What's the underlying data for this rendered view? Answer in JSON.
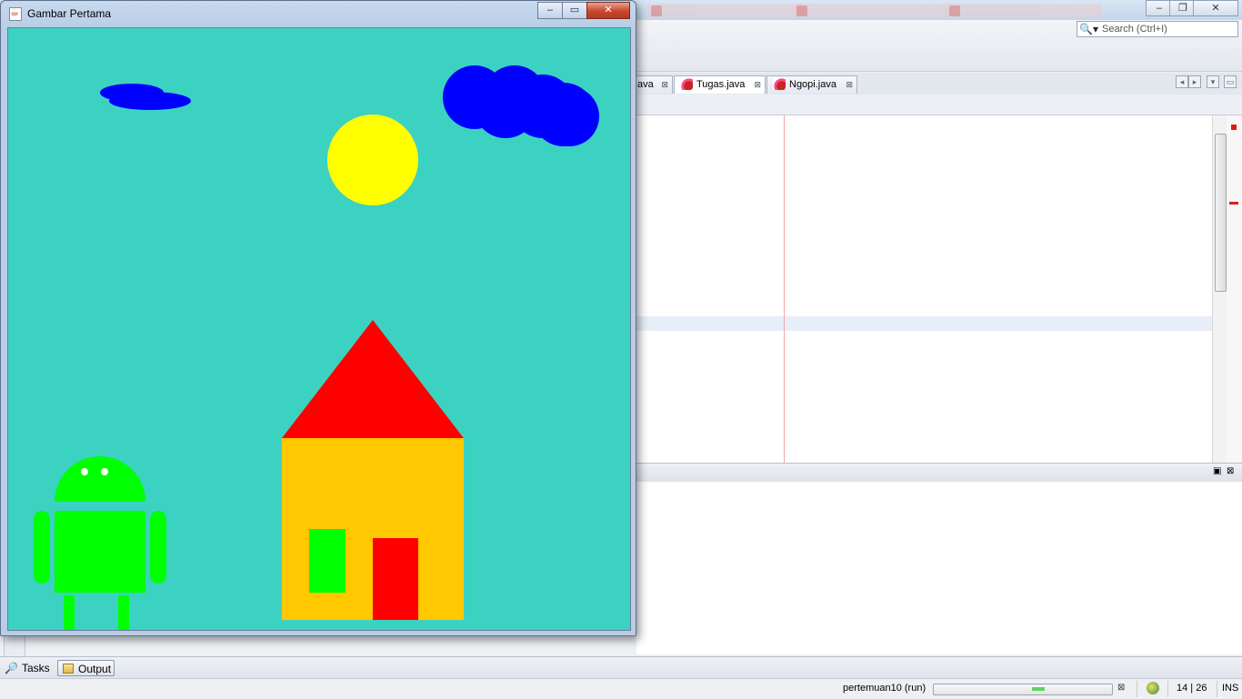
{
  "ide": {
    "search_placeholder": "Search (Ctrl+I)",
    "editor_tabs": [
      {
        "label": "ava",
        "active": false
      },
      {
        "label": "Tugas.java",
        "active": true
      },
      {
        "label": "Ngopi.java",
        "active": false
      }
    ],
    "bottom_tabs": {
      "tasks": "Tasks",
      "output": "Output"
    },
    "status": {
      "run_label": "pertemuan10 (run)",
      "cursor_position": "14 | 26",
      "insert_mode": "INS"
    }
  },
  "java_window": {
    "title": "Gambar Pertama",
    "controls": {
      "minimize": "–",
      "maximize": "▭",
      "close": "✕"
    },
    "scene_colors": {
      "sky": "#3cd2c2",
      "cloud": "#0000ff",
      "sun": "#ffff00",
      "roof": "#ff0000",
      "wall": "#ffc800",
      "window": "#00ff00",
      "door": "#ff0000",
      "robot": "#00ff00",
      "robot_eyes": "#ffffff"
    }
  }
}
